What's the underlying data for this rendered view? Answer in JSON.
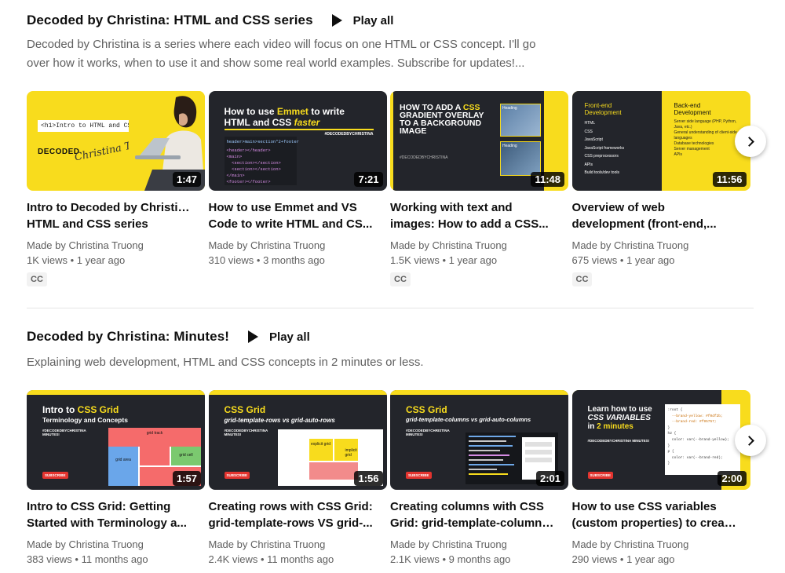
{
  "sections": [
    {
      "title": "Decoded by Christina: HTML and CSS series",
      "play_all": "Play all",
      "description_line1": "Decoded by Christina is a series where each video will focus on one HTML or CSS concept. I'll go",
      "description_line2": "over how it works, when to use it and show some real world examples. Subscribe for updates!...",
      "videos": [
        {
          "title_line1": "Intro to Decoded by Christina:",
          "title_line2": "HTML and CSS series",
          "channel": "Made by Christina Truong",
          "meta": "1K views • 1 year ago",
          "duration": "1:47",
          "cc": "CC",
          "thumb": {
            "code": "<h1>Intro to HTML and CSS</h1>",
            "logo": "DECODED",
            "signature": "Christina Truong"
          }
        },
        {
          "title_line1": "How to use Emmet and VS",
          "title_line2": "Code to write HTML and CS...",
          "channel": "Made by Christina Truong",
          "meta": "310 views • 3 months ago",
          "duration": "7:21",
          "thumb": {
            "heading_pre": "How to use ",
            "heading_em": "Emmet",
            "heading_post": " to write",
            "heading2_pre": "HTML and CSS ",
            "heading2_em": "faster",
            "tag": "#DECODEDBYCHRISTINA",
            "code_lines": [
              "header>main>section*2+footer",
              "<header></header>",
              "<main>",
              "  <section></section>",
              "  <section></section>",
              "</main>",
              "<footer></footer>"
            ]
          }
        },
        {
          "title_line1": "Working with text and",
          "title_line2": "images: How to add a CSS...",
          "channel": "Made by Christina Truong",
          "meta": "1.5K views • 1 year ago",
          "duration": "11:48",
          "cc": "CC",
          "thumb": {
            "heading_l1a": "HOW TO ADD A ",
            "heading_l1b": "CSS",
            "heading_l2": "GRADIENT OVERLAY",
            "heading_l3": "TO A BACKGROUND",
            "heading_l4": "IMAGE",
            "tag": "#DECODEDBYCHRISTINA",
            "card1": "Heading",
            "card2": "Heading"
          }
        },
        {
          "title_line1": "Overview of web",
          "title_line2": "development (front-end,...",
          "channel": "Made by Christina Truong",
          "meta": "675 views • 1 year ago",
          "duration": "11:56",
          "cc": "CC",
          "thumb": {
            "front_title": "Front-end Development",
            "front_items": [
              "HTML",
              "CSS",
              "JavaScript",
              "JavaScript frameworks",
              "CSS preprocessors",
              "APIs",
              "Build tools/dev tools"
            ],
            "back_title": "Back-end Development",
            "back_items": [
              "Server side language (PHP, Python, Java, etc.)",
              "General understanding of client-side languages",
              "Database technologies",
              "Server management",
              "APIs"
            ]
          }
        }
      ]
    },
    {
      "title": "Decoded by Christina: Minutes!",
      "play_all": "Play all",
      "description_line1": "Explaining web development, HTML and CSS concepts in 2 minutes or less.",
      "videos": [
        {
          "title_line1": "Intro to CSS Grid: Getting",
          "title_line2": "Started with Terminology a...",
          "channel": "Made by Christina Truong",
          "meta": "383 views • 11 months ago",
          "duration": "1:57",
          "thumb": {
            "heading_a": "Intro to ",
            "heading_b": "CSS Grid",
            "subheading": "Terminology and Concepts",
            "tag": "#DECODEDBYCHRISTINA MINUTES!",
            "subscribe": "SUBSCRIBE",
            "label_track": "grid track",
            "label_area": "grid area",
            "label_cell": "grid cell"
          }
        },
        {
          "title_line1": "Creating rows with CSS Grid:",
          "title_line2": "grid-template-rows VS grid-...",
          "channel": "Made by Christina Truong",
          "meta": "2.4K views • 11 months ago",
          "duration": "1:56",
          "thumb": {
            "heading": "CSS Grid",
            "subheading": "grid-template-rows vs grid-auto-rows",
            "tag": "#DECODEDBYCHRISTINA MINUTES!",
            "subscribe": "SUBSCRIBE",
            "label_explicit": "explicit grid",
            "label_implicit": "implicit grid"
          }
        },
        {
          "title_line1": "Creating columns with CSS",
          "title_line2": "Grid: grid-template-columns...",
          "channel": "Made by Christina Truong",
          "meta": "2.1K views • 9 months ago",
          "duration": "2:01",
          "thumb": {
            "heading": "CSS Grid",
            "subheading": "grid-template-columns vs grid-auto-columns",
            "tag": "#DECODEDBYCHRISTINA MINUTES!",
            "subscribe": "SUBSCRIBE"
          }
        },
        {
          "title_line1": "How to use CSS variables",
          "title_line2": "(custom properties) to creat...",
          "channel": "Made by Christina Truong",
          "meta": "290 views • 1 year ago",
          "duration": "2:00",
          "thumb": {
            "heading_l1": "Learn how to use",
            "heading_l2": "CSS VARIABLES",
            "heading_l3a": "in ",
            "heading_l3b": "2 minutes",
            "tag": "#DECODEDBYCHRISTINA MINUTES!",
            "subscribe": "SUBSCRIBE",
            "code_lines": [
              ":root {",
              "  --brand-yellow: #f0df2b;",
              "  --brand-red: #f95757;",
              "}",
              "h2 {",
              "  color: var(--brand-yellow);",
              "}",
              "p {",
              "  color: var(--brand-red);",
              "}"
            ]
          }
        }
      ]
    }
  ],
  "colors": {
    "brand_yellow": "#f8dc1d",
    "dark": "#23252b",
    "subscribe_red": "#e3342f"
  }
}
